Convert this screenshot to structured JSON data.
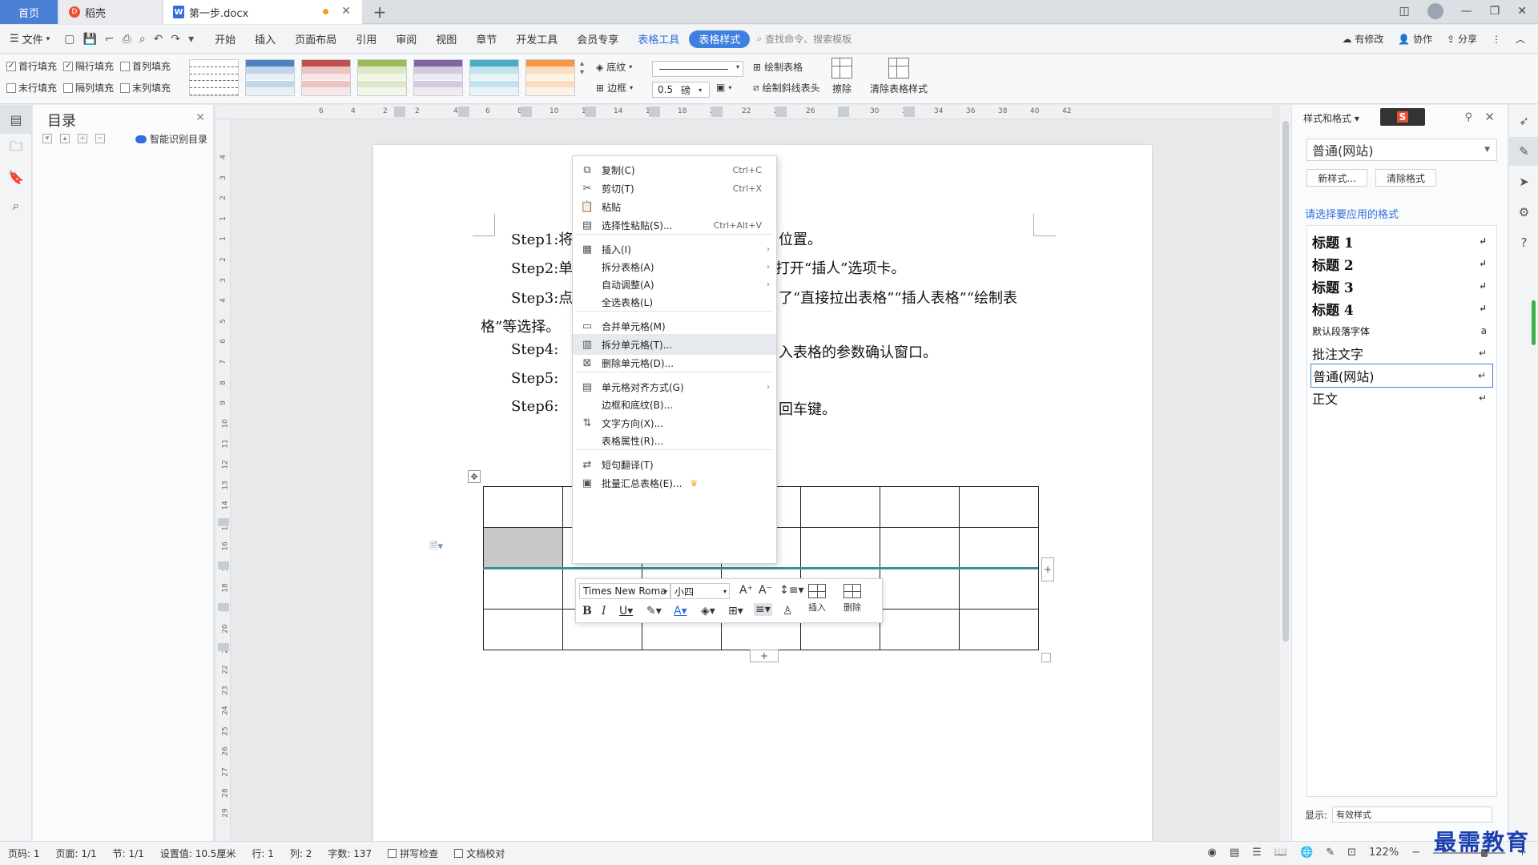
{
  "tabs": {
    "home": "首页",
    "daoke": "稻壳",
    "doc": "第一步.docx",
    "add": "+"
  },
  "menubar": {
    "file": "文件",
    "items": [
      "开始",
      "插入",
      "页面布局",
      "引用",
      "审阅",
      "视图",
      "章节",
      "开发工具",
      "会员专享",
      "表格工具",
      "表格样式"
    ],
    "search_placeholder": "查找命令、搜索模板",
    "right": [
      "有修改",
      "协作",
      "分享"
    ]
  },
  "ribbon": {
    "checkboxes": [
      {
        "label": "首行填充",
        "checked": true
      },
      {
        "label": "隔行填充",
        "checked": true
      },
      {
        "label": "首列填充",
        "checked": false
      },
      {
        "label": "末行填充",
        "checked": false
      },
      {
        "label": "隔列填充",
        "checked": false
      },
      {
        "label": "末列填充",
        "checked": false
      }
    ],
    "shading": "底纹",
    "border": "边框",
    "line_width": "0.5",
    "line_unit": "磅",
    "draw_table": "绘制表格",
    "draw_diagonal": "绘制斜线表头",
    "erase": "擦除",
    "clear_style": "清除表格样式",
    "swatch_colors": [
      "#888888",
      "#4f81bd",
      "#c0504d",
      "#9bbb59",
      "#8064a2",
      "#4bacc6",
      "#f79646"
    ]
  },
  "toc": {
    "title": "目录",
    "smart": "智能识别目录"
  },
  "ruler": {
    "h_numbers": [
      "6",
      "4",
      "2",
      "2",
      "4",
      "6",
      "8",
      "10",
      "12",
      "14",
      "16",
      "18",
      "20",
      "22",
      "24",
      "26",
      "28",
      "30",
      "32",
      "34",
      "36",
      "38",
      "40",
      "42"
    ],
    "v_numbers": [
      "4",
      "3",
      "2",
      "1",
      "1",
      "2",
      "3",
      "4",
      "5",
      "6",
      "7",
      "8",
      "9",
      "10",
      "11",
      "12",
      "13",
      "14",
      "15",
      "16",
      "17",
      "18",
      "19",
      "20",
      "21",
      "22",
      "23",
      "24",
      "25",
      "26",
      "27",
      "28",
      "29"
    ]
  },
  "document": {
    "lines": [
      {
        "text": "Step1:将",
        "tail": "位置。"
      },
      {
        "text": "Step2:单",
        "tail": "打开“插人”选项卡。"
      },
      {
        "text": "Step3:点",
        "tail": "了“直接拉出表格”“插人表格”“绘制表"
      },
      {
        "text": "格”等选择。",
        "tail": ""
      },
      {
        "text": "Step4:",
        "tail": "入表格的参数确认窗口。"
      },
      {
        "text": "Step5:",
        "tail": ""
      },
      {
        "text": "Step6:",
        "tail": "回车键。"
      }
    ],
    "table_rows": 4,
    "table_cols": 7
  },
  "context_menu": {
    "items": [
      {
        "icon": "copy-icon",
        "glyph": "⧉",
        "label": "复制(C)",
        "shortcut": "Ctrl+C"
      },
      {
        "icon": "cut-icon",
        "glyph": "✂",
        "label": "剪切(T)",
        "shortcut": "Ctrl+X"
      },
      {
        "icon": "paste-icon",
        "glyph": "📋",
        "label": "粘贴",
        "shortcut": ""
      },
      {
        "icon": "paste-special-icon",
        "glyph": "▤",
        "label": "选择性粘贴(S)...",
        "shortcut": "Ctrl+Alt+V"
      },
      {
        "icon": "insert-table-icon",
        "glyph": "▦",
        "label": "插入(I)",
        "submenu": true
      },
      {
        "icon": "",
        "glyph": "",
        "label": "拆分表格(A)",
        "submenu": true
      },
      {
        "icon": "",
        "glyph": "",
        "label": "自动调整(A)",
        "submenu": true
      },
      {
        "icon": "",
        "glyph": "",
        "label": "全选表格(L)"
      },
      {
        "icon": "merge-cells-icon",
        "glyph": "▭",
        "label": "合并单元格(M)"
      },
      {
        "icon": "split-cells-icon",
        "glyph": "▥",
        "label": "拆分单元格(T)...",
        "highlighted": true
      },
      {
        "icon": "delete-cells-icon",
        "glyph": "⊠",
        "label": "删除单元格(D)..."
      },
      {
        "icon": "cell-align-icon",
        "glyph": "▤",
        "label": "单元格对齐方式(G)",
        "submenu": true
      },
      {
        "icon": "",
        "glyph": "",
        "label": "边框和底纹(B)..."
      },
      {
        "icon": "text-direction-icon",
        "glyph": "⇅",
        "label": "文字方向(X)..."
      },
      {
        "icon": "",
        "glyph": "",
        "label": "表格属性(R)..."
      },
      {
        "icon": "translate-icon",
        "glyph": "⇄",
        "label": "短句翻译(T)"
      },
      {
        "icon": "batch-summary-icon",
        "glyph": "▣",
        "label": "批量汇总表格(E)...",
        "crown": true
      }
    ]
  },
  "minibar": {
    "font": "Times New Roma",
    "size": "小四",
    "insert": "插入",
    "delete": "删除"
  },
  "style_panel": {
    "header": "样式和格式",
    "current": "普通(网站)",
    "new_style": "新样式...",
    "clear_format": "清除格式",
    "hint": "请选择要应用的格式",
    "styles": [
      {
        "label": "标题  1",
        "kind": "h"
      },
      {
        "label": "标题  2",
        "kind": "h"
      },
      {
        "label": "标题  3",
        "kind": "h"
      },
      {
        "label": "标题  4",
        "kind": "h"
      },
      {
        "label": "默认段落字体",
        "kind": "small",
        "mark": "a"
      },
      {
        "label": "批注文字",
        "kind": "plain"
      },
      {
        "label": "普通(网站)",
        "kind": "plain",
        "selected": true
      },
      {
        "label": "正文",
        "kind": "plain"
      }
    ],
    "show_label": "显示:",
    "show_value": "有效样式"
  },
  "statusbar": {
    "items": [
      "页码: 1",
      "页面: 1/1",
      "节: 1/1",
      "设置值: 10.5厘米",
      "行: 1",
      "列: 2",
      "字数: 137"
    ],
    "spell": "拼写检查",
    "proof": "文档校对",
    "zoom": "122%"
  },
  "watermark": "最需教育"
}
